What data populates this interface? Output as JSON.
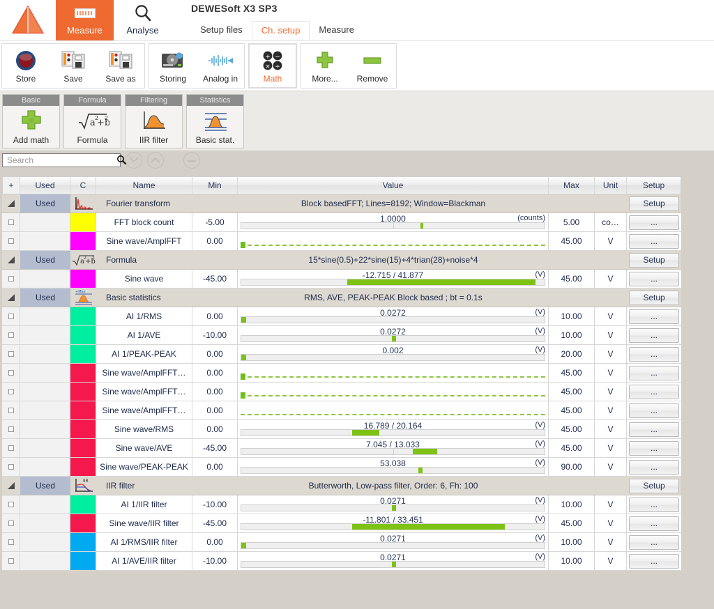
{
  "app": {
    "title": "DEWESoft X3 SP3",
    "logo_icon": "dewesoft-triangle-logo"
  },
  "modes": [
    {
      "label": "Measure",
      "icon": "measure-icon",
      "active": true
    },
    {
      "label": "Analyse",
      "icon": "magnifier-icon",
      "active": false
    }
  ],
  "tabs": [
    {
      "label": "Setup files",
      "active": false
    },
    {
      "label": "Ch. setup",
      "active": true
    },
    {
      "label": "Measure",
      "active": false
    }
  ],
  "ribbon": {
    "groups": [
      {
        "buttons": [
          {
            "label": "Store",
            "icon": "record-circle-icon",
            "selected": false
          },
          {
            "label": "Save",
            "icon": "save-disk-icon",
            "selected": false
          },
          {
            "label": "Save as",
            "icon": "save-as-disk-icon",
            "selected": false
          }
        ]
      },
      {
        "buttons": [
          {
            "label": "Storing",
            "icon": "hard-disk-icon",
            "selected": false
          },
          {
            "label": "Analog in",
            "icon": "waveform-icon",
            "selected": false
          }
        ]
      },
      {
        "buttons": [
          {
            "label": "Math",
            "icon": "math-operators-icon",
            "selected": true
          }
        ]
      },
      {
        "buttons": [
          {
            "label": "More...",
            "icon": "green-plus-icon",
            "selected": false
          },
          {
            "label": "Remove",
            "icon": "green-minus-icon",
            "selected": false
          }
        ]
      }
    ]
  },
  "math_modules": [
    {
      "group": "Basic",
      "label": "Add math",
      "icon": "green-plus-icon"
    },
    {
      "group": "Formula",
      "label": "Formula",
      "icon": "sqrt-formula-icon"
    },
    {
      "group": "Filtering",
      "label": "IIR filter",
      "icon": "filter-curve-icon"
    },
    {
      "group": "Statistics",
      "label": "Basic stat.",
      "icon": "statistics-curve-icon"
    }
  ],
  "search": {
    "value": "",
    "placeholder": "Search",
    "icon": "search-icon",
    "buttons": [
      {
        "icon": "chevron-down-icon"
      },
      {
        "icon": "chevron-up-icon"
      },
      {
        "icon": "collapse-icon"
      }
    ]
  },
  "table": {
    "headers": {
      "plus": "+",
      "used": "Used",
      "c": "C",
      "name": "Name",
      "min": "Min",
      "value": "Value",
      "max": "Max",
      "unit": "Unit",
      "setup": "Setup"
    },
    "setup_label": "Setup",
    "row_setup_label": "...",
    "groups": [
      {
        "used": "Used",
        "name": "Fourier transform",
        "icon": "fft-spectrum-icon",
        "description": "Block basedFFT; Lines=8192; Window=Blackman",
        "rows": [
          {
            "color": "#ffff00",
            "name": "FFT block count",
            "min": "-5.00",
            "value": "1.0000",
            "unit_paren": "(counts)",
            "max": "5.00",
            "unit": "co…",
            "bar": {
              "type": "marker",
              "pos": 59,
              "tick": 50
            }
          },
          {
            "color": "#ff00ff",
            "name": "Sine wave/AmplFFT",
            "min": "0.00",
            "value": "",
            "unit_paren": "",
            "max": "45.00",
            "unit": "V",
            "bar": {
              "type": "dashed",
              "dot": true
            }
          }
        ]
      },
      {
        "used": "Used",
        "name": "Formula",
        "icon": "sqrt-formula-icon",
        "description": "15*sine(0.5)+22*sine(15)+4*trian(28)+noise*4",
        "rows": [
          {
            "color": "#ff00ff",
            "name": "Sine wave",
            "min": "-45.00",
            "value": "-12.715 / 41.877",
            "unit_paren": "(V)",
            "max": "45.00",
            "unit": "V",
            "bar": {
              "type": "range",
              "start": 35,
              "end": 97,
              "tick": 50
            }
          }
        ]
      },
      {
        "used": "Used",
        "name": "Basic statistics",
        "icon": "statistics-curve-icon",
        "description": "RMS, AVE, PEAK-PEAK Block based ; bt = 0.1s",
        "rows": [
          {
            "color": "#00eea0",
            "name": "AI 1/RMS",
            "min": "0.00",
            "value": "0.0272",
            "unit_paren": "(V)",
            "max": "10.00",
            "unit": "V",
            "bar": {
              "type": "range",
              "start": 0,
              "end": 1.5
            }
          },
          {
            "color": "#00eea0",
            "name": "AI 1/AVE",
            "min": "-10.00",
            "value": "0.0272",
            "unit_paren": "(V)",
            "max": "10.00",
            "unit": "V",
            "bar": {
              "type": "range",
              "start": 49.6,
              "end": 51.1
            }
          },
          {
            "color": "#00eea0",
            "name": "AI 1/PEAK-PEAK",
            "min": "0.00",
            "value": "0.002",
            "unit_paren": "(V)",
            "max": "20.00",
            "unit": "V",
            "bar": {
              "type": "range",
              "start": 0,
              "end": 1.5
            }
          },
          {
            "color": "#f4184c",
            "name": "Sine wave/AmplFFT…",
            "min": "0.00",
            "value": "",
            "unit_paren": "",
            "max": "45.00",
            "unit": "V",
            "bar": {
              "type": "dashed",
              "dot": true
            }
          },
          {
            "color": "#f4184c",
            "name": "Sine wave/AmplFFT…",
            "min": "0.00",
            "value": "",
            "unit_paren": "",
            "max": "45.00",
            "unit": "V",
            "bar": {
              "type": "dashed",
              "dot": true
            }
          },
          {
            "color": "#f4184c",
            "name": "Sine wave/AmplFFT…",
            "min": "0.00",
            "value": "",
            "unit_paren": "",
            "max": "45.00",
            "unit": "V",
            "bar": {
              "type": "dashed",
              "dot": false
            }
          },
          {
            "color": "#f4184c",
            "name": "Sine wave/RMS",
            "min": "0.00",
            "value": "16.789 / 20.164",
            "unit_paren": "(V)",
            "max": "45.00",
            "unit": "V",
            "bar": {
              "type": "range",
              "start": 36.5,
              "end": 45.5
            }
          },
          {
            "color": "#f4184c",
            "name": "Sine wave/AVE",
            "min": "-45.00",
            "value": "7.045 / 13.033",
            "unit_paren": "(V)",
            "max": "45.00",
            "unit": "V",
            "bar": {
              "type": "range",
              "start": 56.5,
              "end": 64.5,
              "tick": 50
            }
          },
          {
            "color": "#f4184c",
            "name": "Sine wave/PEAK-PEAK",
            "min": "0.00",
            "value": "53.038",
            "unit_paren": "(V)",
            "max": "90.00",
            "unit": "V",
            "bar": {
              "type": "range",
              "start": 58.5,
              "end": 59.8
            }
          }
        ]
      },
      {
        "used": "Used",
        "name": "IIR filter",
        "icon": "iir-filter-icon",
        "description": "Butterworth,  Low-pass filter, Order: 6,  Fh: 100",
        "rows": [
          {
            "color": "#00eea0",
            "name": "AI 1/IIR filter",
            "min": "-10.00",
            "value": "0.0271",
            "unit_paren": "(V)",
            "max": "10.00",
            "unit": "V",
            "bar": {
              "type": "range",
              "start": 49.6,
              "end": 51.1
            }
          },
          {
            "color": "#f4184c",
            "name": "Sine wave/IIR filter",
            "min": "-45.00",
            "value": "-11.801 / 33.451",
            "unit_paren": "(V)",
            "max": "45.00",
            "unit": "V",
            "bar": {
              "type": "range",
              "start": 36.5,
              "end": 87,
              "tick": 50
            }
          },
          {
            "color": "#00aaf0",
            "name": "AI 1/RMS/IIR filter",
            "min": "0.00",
            "value": "0.0271",
            "unit_paren": "(V)",
            "max": "10.00",
            "unit": "V",
            "bar": {
              "type": "range",
              "start": 0,
              "end": 1.5
            }
          },
          {
            "color": "#00aaf0",
            "name": "AI 1/AVE/IIR filter",
            "min": "-10.00",
            "value": "0.0271",
            "unit_paren": "(V)",
            "max": "10.00",
            "unit": "V",
            "bar": {
              "type": "range",
              "start": 49.6,
              "end": 51.1
            }
          }
        ]
      }
    ]
  }
}
